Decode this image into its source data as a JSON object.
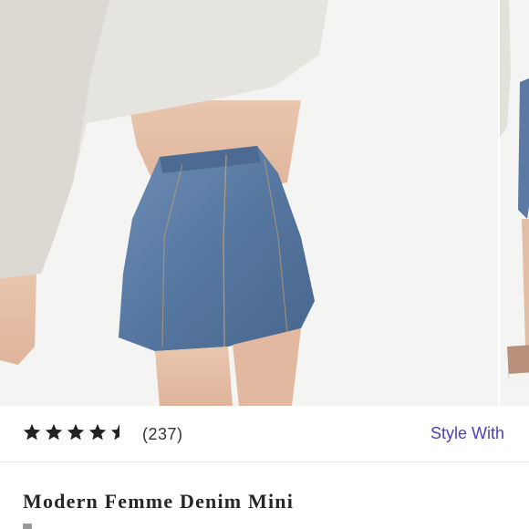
{
  "gallery": {
    "main_image_alt": "",
    "next_image_alt": ""
  },
  "rating": {
    "stars": 4.5,
    "max_stars": 5,
    "review_count": "(237)"
  },
  "actions": {
    "style_with_label": "Style With"
  },
  "product": {
    "title": "Modern Femme Denim Mini"
  },
  "colors": {
    "accent": "#4b3fb5",
    "star": "#222222",
    "denim": "#5878a0",
    "sweater": "#e6e4de"
  }
}
